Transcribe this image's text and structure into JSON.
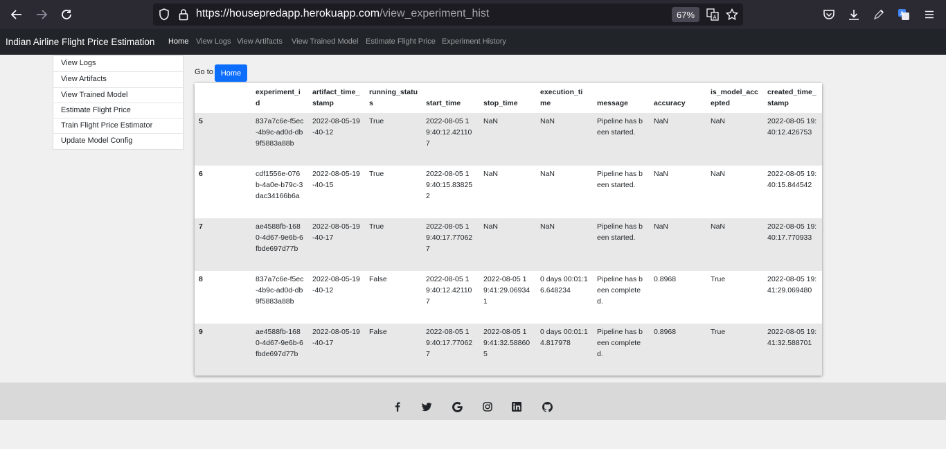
{
  "browser": {
    "url_host": "https://housepredapp.herokuapp.com",
    "url_path": "/view_experiment_hist",
    "zoom": "67%",
    "icons": [
      "back-icon",
      "forward-icon",
      "reload-icon",
      "shield-icon",
      "lock-icon",
      "translate-icon",
      "bookmark-star-icon",
      "pocket-icon",
      "download-icon",
      "pen-icon",
      "extension-translate-icon",
      "menu-icon"
    ]
  },
  "navbar": {
    "brand": "Indian Airline Flight Price Estimation",
    "links": [
      "Home",
      "View Logs",
      "View Artifacts",
      "View Trained Model",
      "Estimate Flight Price",
      "Experiment History"
    ],
    "active": "Home"
  },
  "sidebar": {
    "items": [
      "View Logs",
      "View Artifacts",
      "View Trained Model",
      "Estimate Flight Price",
      "Train Flight Price Estimator",
      "Update Model Config"
    ]
  },
  "goto": {
    "label": "Go to",
    "button": "Home"
  },
  "table": {
    "headers": [
      "",
      "experiment_id",
      "artifact_time_stamp",
      "running_status",
      "start_time",
      "stop_time",
      "execution_time",
      "message",
      "accuracy",
      "is_model_accepted",
      "created_time_stamp"
    ],
    "rows": [
      [
        "5",
        "837a7c6e-f5ec-4b9c-ad0d-db9f5883a88b",
        "2022-08-05-19-40-12",
        "True",
        "2022-08-05 19:40:12.421107",
        "NaN",
        "NaN",
        "Pipeline has been started.",
        "NaN",
        "NaN",
        "2022-08-05 19:40:12.426753"
      ],
      [
        "6",
        "cdf1556e-076b-4a0e-b79c-3dac34166b6a",
        "2022-08-05-19-40-15",
        "True",
        "2022-08-05 19:40:15.838252",
        "NaN",
        "NaN",
        "Pipeline has been started.",
        "NaN",
        "NaN",
        "2022-08-05 19:40:15.844542"
      ],
      [
        "7",
        "ae4588fb-1680-4d67-9e6b-6fbde697d77b",
        "2022-08-05-19-40-17",
        "True",
        "2022-08-05 19:40:17.770627",
        "NaN",
        "NaN",
        "Pipeline has been started.",
        "NaN",
        "NaN",
        "2022-08-05 19:40:17.770933"
      ],
      [
        "8",
        "837a7c6e-f5ec-4b9c-ad0d-db9f5883a88b",
        "2022-08-05-19-40-12",
        "False",
        "2022-08-05 19:40:12.421107",
        "2022-08-05 19:41:29.069341",
        "0 days 00:01:16.648234",
        "Pipeline has been completed.",
        "0.8968",
        "True",
        "2022-08-05 19:41:29.069480"
      ],
      [
        "9",
        "ae4588fb-1680-4d67-9e6b-6fbde697d77b",
        "2022-08-05-19-40-17",
        "False",
        "2022-08-05 19:40:17.770627",
        "2022-08-05 19:41:32.588605",
        "0 days 00:01:14.817978",
        "Pipeline has been completed.",
        "0.8968",
        "True",
        "2022-08-05 19:41:32.588701"
      ]
    ]
  },
  "footer": {
    "icons": [
      "facebook-icon",
      "twitter-icon",
      "google-icon",
      "instagram-icon",
      "linkedin-icon",
      "github-icon"
    ]
  },
  "colors": {
    "browser_bg": "#2b2a33",
    "navbar_bg": "#212529",
    "primary_button": "#0d6efd",
    "stripe": "#e8e8e8",
    "footer_bg": "#d9d9d9"
  }
}
